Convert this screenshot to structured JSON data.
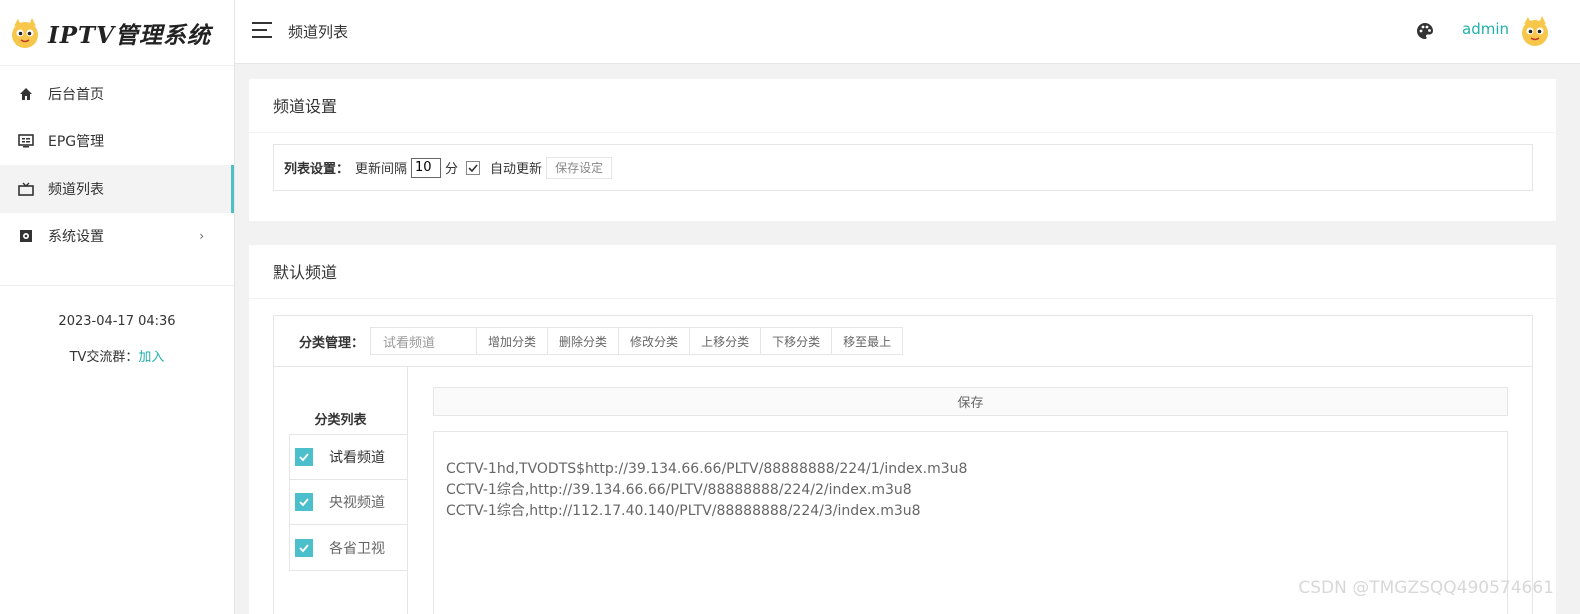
{
  "app": {
    "logo_text": "IPTV管理系统",
    "accent": "#4ec2c3"
  },
  "sidebar": {
    "items": [
      {
        "label": "后台首页",
        "icon": "home-icon"
      },
      {
        "label": "EPG管理",
        "icon": "epg-icon"
      },
      {
        "label": "频道列表",
        "icon": "tv-icon",
        "active": true
      },
      {
        "label": "系统设置",
        "icon": "settings-icon",
        "arrow": "›"
      }
    ],
    "datetime": "2023-04-17 04:36",
    "group_label": "TV交流群：",
    "group_link": "加入"
  },
  "header": {
    "page_title": "频道列表",
    "user": "admin"
  },
  "channel_settings": {
    "title": "频道设置",
    "list_label": "列表设置：",
    "interval_label": "更新间隔",
    "interval_value": "10",
    "unit": "分",
    "auto_update_label": "自动更新",
    "auto_update_checked": true,
    "save_button": "保存设定"
  },
  "default_channels": {
    "title": "默认频道",
    "category_label": "分类管理：",
    "category_input": "试看频道",
    "buttons": [
      "增加分类",
      "删除分类",
      "修改分类",
      "上移分类",
      "下移分类",
      "移至最上"
    ],
    "list_title": "分类列表",
    "categories": [
      {
        "name": "试看频道",
        "checked": true
      },
      {
        "name": "央视频道",
        "checked": true
      },
      {
        "name": "各省卫视",
        "checked": true
      }
    ],
    "save_label": "保存",
    "channels": [
      "CCTV-1hd,TVODTS$http://39.134.66.66/PLTV/88888888/224/1/index.m3u8",
      "CCTV-1综合,http://39.134.66.66/PLTV/88888888/224/2/index.m3u8",
      "CCTV-1综合,http://112.17.40.140/PLTV/88888888/224/3/index.m3u8"
    ]
  },
  "watermark": "CSDN @TMGZSQQ490574661"
}
